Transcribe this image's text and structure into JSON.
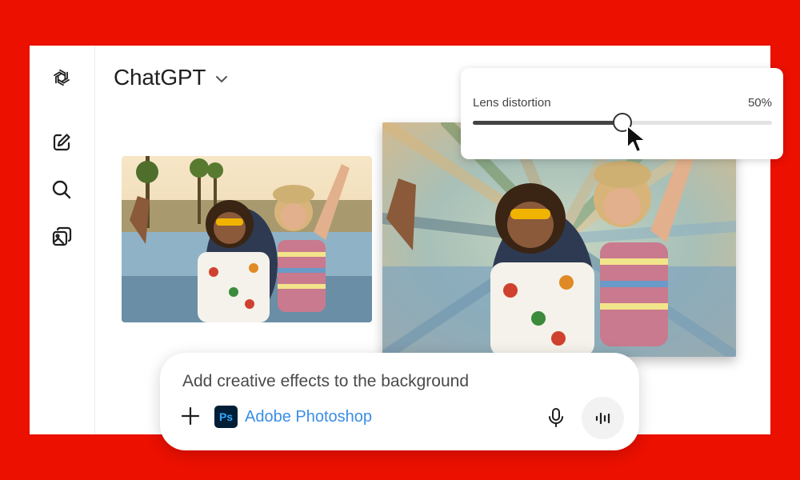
{
  "header": {
    "model_name": "ChatGPT",
    "logo_icon": "openai-logo-icon",
    "model_chevron_icon": "chevron-down-icon"
  },
  "sidebar": {
    "items": [
      {
        "icon": "new-chat-icon"
      },
      {
        "icon": "search-icon"
      },
      {
        "icon": "images-icon"
      }
    ]
  },
  "images": {
    "original": {
      "description_icon": "photo-original"
    },
    "edited": {
      "description_icon": "photo-lens-distortion"
    }
  },
  "slider": {
    "label": "Lens distortion",
    "value_text": "50%",
    "value": 0.5
  },
  "composer": {
    "input_text": "Add creative effects to the background",
    "tool_logo": "Ps",
    "tool_label": "Adobe Photoshop",
    "plus_icon": "plus-icon",
    "mic_icon": "microphone-icon",
    "voice_icon": "voice-mode-icon"
  },
  "colors": {
    "background": "#eb1000",
    "photoshop_brand": "#001e36",
    "photoshop_accent": "#31a8ff",
    "tool_label": "#3a8ee6"
  }
}
